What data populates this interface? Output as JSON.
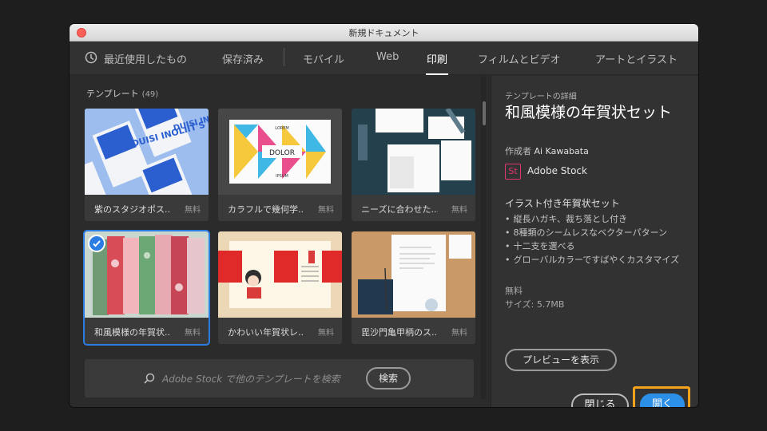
{
  "window": {
    "title": "新規ドキュメント"
  },
  "tabs": [
    {
      "label": "最近使用したもの"
    },
    {
      "label": "保存済み"
    },
    {
      "label": "モバイル"
    },
    {
      "label": "Web"
    },
    {
      "label": "印刷"
    },
    {
      "label": "フィルムとビデオ"
    },
    {
      "label": "アートとイラスト"
    }
  ],
  "active_tab": "印刷",
  "templates": {
    "heading": "テンプレート",
    "count": "(49)",
    "items": [
      {
        "name": "紫のスタジオポス...",
        "price": "無料",
        "thumb_texts": [
          "DUISI INOLIIT'S GRIS",
          "DUISI INOLIIT'S GRIS"
        ]
      },
      {
        "name": "カラフルで幾何学...",
        "price": "無料",
        "thumb_texts": [
          "LOREM",
          "DOLOR",
          "IPSUM"
        ]
      },
      {
        "name": "ニーズに合わせた...",
        "price": "無料",
        "thumb_texts": []
      },
      {
        "name": "和風模様の年賀状...",
        "price": "無料",
        "selected": true,
        "thumb_texts": []
      },
      {
        "name": "かわいい年賀状レ...",
        "price": "無料",
        "thumb_texts": []
      },
      {
        "name": "毘沙門亀甲柄のス...",
        "price": "無料",
        "thumb_texts": []
      }
    ]
  },
  "search": {
    "placeholder": "Adobe Stock で他のテンプレートを検索",
    "button": "検索"
  },
  "details": {
    "label": "テンプレートの詳細",
    "title": "和風模様の年賀状セット",
    "author_prefix": "作成者",
    "author": "Ai Kawabata",
    "stock_logo": "St",
    "stock_label": "Adobe Stock",
    "subtitle": "イラスト付き年賀状セット",
    "bullets": [
      "縦長ハガキ、裁ち落とし付き",
      "8種類のシームレスなベクターパターン",
      "十二支を選べる",
      "グローバルカラーですばやくカスタマイズ"
    ],
    "price": "無料",
    "size": "サイズ: 5.7MB",
    "preview_button": "プレビューを表示"
  },
  "footer": {
    "close_button": "閉じる",
    "open_button": "開く"
  },
  "colors": {
    "accent": "#2c8fe8",
    "highlight": "#f5a31a",
    "selection": "#2c7de3",
    "stock": "#e0356f"
  }
}
